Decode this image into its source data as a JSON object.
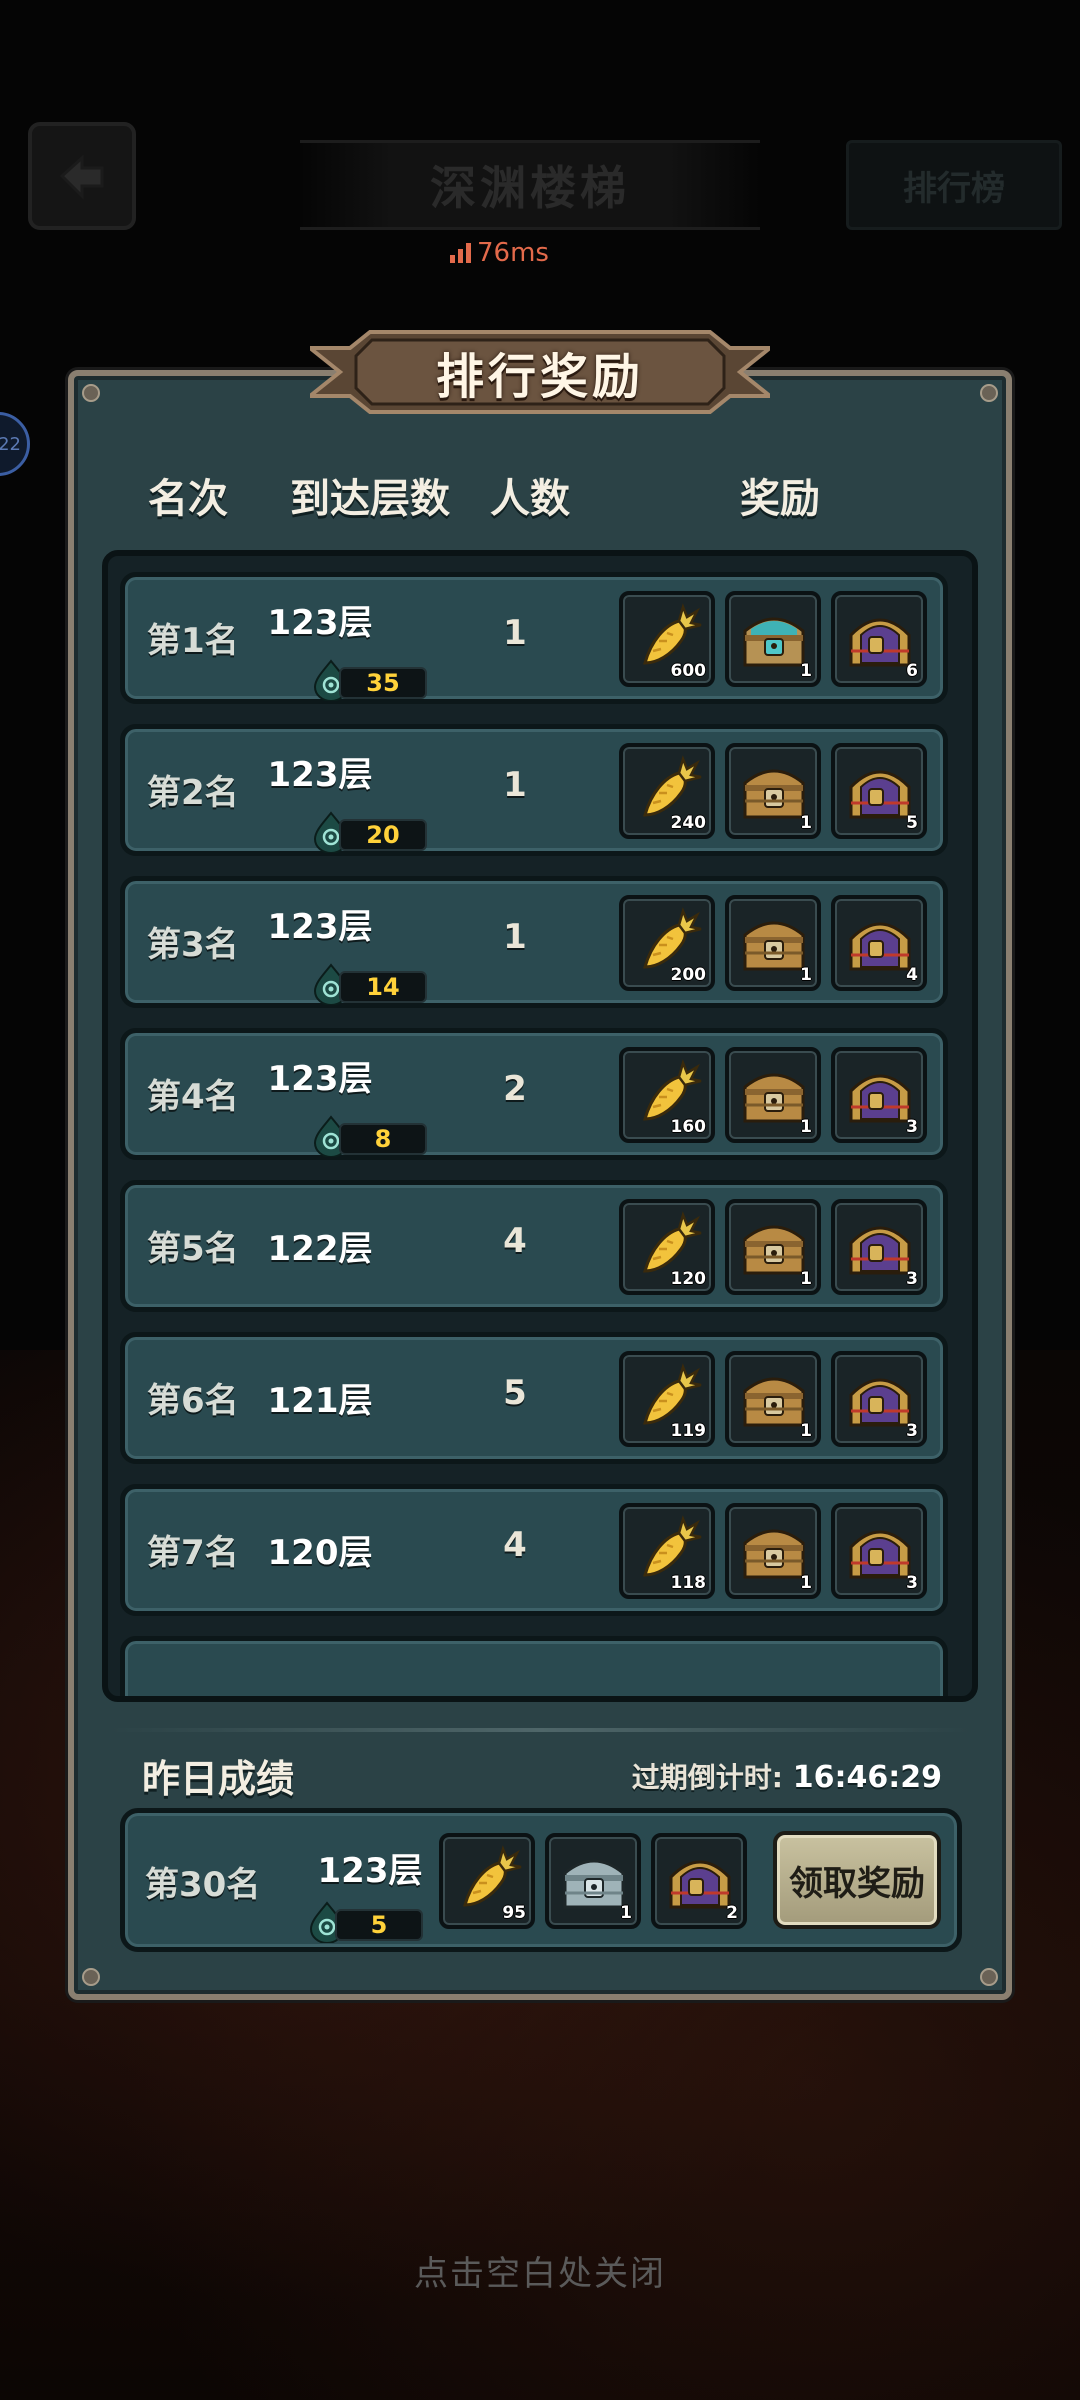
{
  "top": {
    "title": "深渊楼梯",
    "rank_button": "排行榜",
    "ping": "76ms",
    "side_bubble": "22"
  },
  "panel": {
    "title": "排行奖励",
    "headers": {
      "rank": "名次",
      "floor": "到达层数",
      "count": "人数",
      "reward": "奖励"
    },
    "rows": [
      {
        "rank": "第1名",
        "floor": "123层",
        "badge": "35",
        "count": "1",
        "rewards": [
          {
            "icon": "carrot-icon",
            "qty": "600"
          },
          {
            "icon": "teal-chest-icon",
            "qty": "1"
          },
          {
            "icon": "purple-chest-icon",
            "qty": "6"
          }
        ]
      },
      {
        "rank": "第2名",
        "floor": "123层",
        "badge": "20",
        "count": "1",
        "rewards": [
          {
            "icon": "carrot-icon",
            "qty": "240"
          },
          {
            "icon": "gold-chest-icon",
            "qty": "1"
          },
          {
            "icon": "purple-chest-icon",
            "qty": "5"
          }
        ]
      },
      {
        "rank": "第3名",
        "floor": "123层",
        "badge": "14",
        "count": "1",
        "rewards": [
          {
            "icon": "carrot-icon",
            "qty": "200"
          },
          {
            "icon": "gold-chest-icon",
            "qty": "1"
          },
          {
            "icon": "purple-chest-icon",
            "qty": "4"
          }
        ]
      },
      {
        "rank": "第4名",
        "floor": "123层",
        "badge": "8",
        "count": "2",
        "rewards": [
          {
            "icon": "carrot-icon",
            "qty": "160"
          },
          {
            "icon": "gold-chest-icon",
            "qty": "1"
          },
          {
            "icon": "purple-chest-icon",
            "qty": "3"
          }
        ]
      },
      {
        "rank": "第5名",
        "floor": "122层",
        "badge": "",
        "count": "4",
        "rewards": [
          {
            "icon": "carrot-icon",
            "qty": "120"
          },
          {
            "icon": "gold-chest-icon",
            "qty": "1"
          },
          {
            "icon": "purple-chest-icon",
            "qty": "3"
          }
        ]
      },
      {
        "rank": "第6名",
        "floor": "121层",
        "badge": "",
        "count": "5",
        "rewards": [
          {
            "icon": "carrot-icon",
            "qty": "119"
          },
          {
            "icon": "gold-chest-icon",
            "qty": "1"
          },
          {
            "icon": "purple-chest-icon",
            "qty": "3"
          }
        ]
      },
      {
        "rank": "第7名",
        "floor": "120层",
        "badge": "",
        "count": "4",
        "rewards": [
          {
            "icon": "carrot-icon",
            "qty": "118"
          },
          {
            "icon": "gold-chest-icon",
            "qty": "1"
          },
          {
            "icon": "purple-chest-icon",
            "qty": "3"
          }
        ]
      }
    ],
    "yesterday": {
      "title": "昨日成绩",
      "countdown_label": "过期倒计时:",
      "countdown_value": "16:46:29",
      "rank": "第30名",
      "floor": "123层",
      "badge": "5",
      "rewards": [
        {
          "icon": "carrot-icon",
          "qty": "95"
        },
        {
          "icon": "silver-chest-icon",
          "qty": "1"
        },
        {
          "icon": "purple-chest-icon",
          "qty": "2"
        }
      ],
      "claim_button": "领取奖励"
    }
  },
  "close_hint": "点击空白处关闭"
}
